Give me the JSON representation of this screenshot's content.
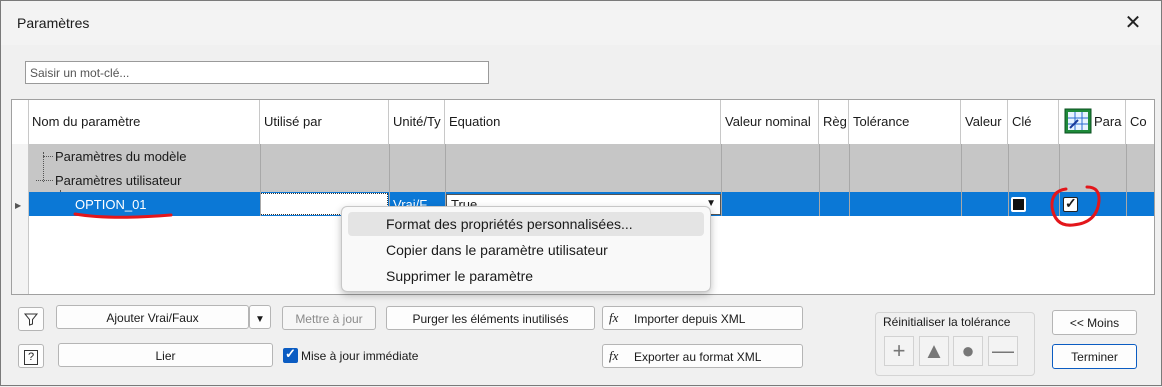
{
  "window": {
    "title": "Paramètres",
    "close_symbol": "✕"
  },
  "search": {
    "placeholder": "Saisir un mot-clé..."
  },
  "grid": {
    "columns": [
      "Nom du paramètre",
      "Utilisé par",
      "Unité/Ty",
      "Equation",
      "Valeur nominal",
      "Règ",
      "Tolérance",
      "Valeur",
      "Clé",
      "Para",
      "Co"
    ],
    "groups": [
      "Paramètres du modèle",
      "Paramètres utilisateur"
    ],
    "row": {
      "name": "OPTION_01",
      "unit": "Vrai/F",
      "equation": "True",
      "equation_arrow": "▼",
      "key_checked": false,
      "param_checked": true
    }
  },
  "context_menu": {
    "items": [
      "Format des propriétés personnalisées...",
      "Copier dans le paramètre utilisateur",
      "Supprimer le paramètre"
    ]
  },
  "toolbar": {
    "add_bool": "Ajouter Vrai/Faux",
    "dropdown_arrow": "▼",
    "update": "Mettre à jour",
    "purge": "Purger les éléments inutilisés",
    "import": "Importer depuis XML",
    "link": "Lier",
    "immediate_update": "Mise à jour immédiate",
    "immediate_update_checked": true,
    "export": "Exporter au format XML",
    "less": "<< Moins",
    "finish": "Terminer",
    "fx": "fx",
    "help": "?"
  },
  "tolerance": {
    "label": "Réinitialiser la tolérance",
    "buttons": [
      "+",
      "▲",
      "●",
      "—"
    ]
  },
  "colors": {
    "selection": "#0b78d6",
    "group_row": "#c6c6c6",
    "annotation": "#e3161b"
  }
}
